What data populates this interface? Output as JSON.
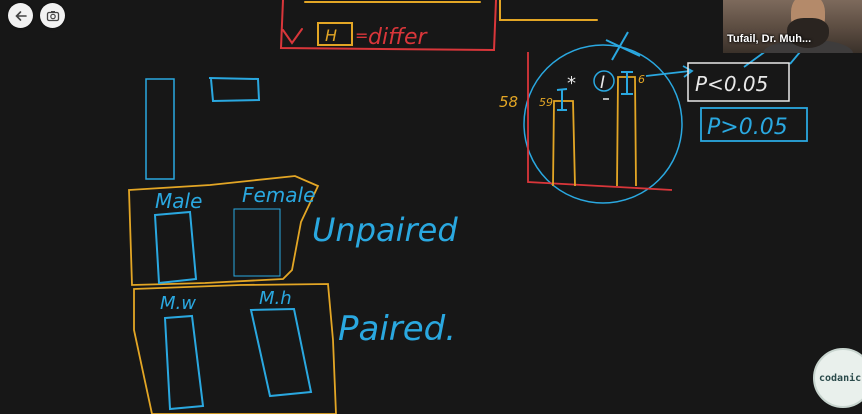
{
  "toolbar": {
    "back_icon": "arrow-left-icon",
    "camera_icon": "camera-switch-icon"
  },
  "participant": {
    "name": "Tufail, Dr. Muh..."
  },
  "logo": {
    "text": "codanics"
  },
  "whiteboard": {
    "top_text_h1": "H",
    "top_text_differ": "differ",
    "plot_y_value": "58",
    "bar_left_label": "59",
    "bar_right_label": "6",
    "star_mark": "*",
    "mid_label": "I",
    "p_less": "P<0.05",
    "p_greater": "P>0.05",
    "male": "Male",
    "female": "Female",
    "unpaired": "Unpaired",
    "mw": "M.w",
    "mh": "M.h",
    "paired": "Paired."
  },
  "colors": {
    "background": "#171717",
    "blue_ink": "#2aa8e0",
    "orange_ink": "#e3a625",
    "red_ink": "#d9363a",
    "white_ink": "#e8e8e8"
  }
}
